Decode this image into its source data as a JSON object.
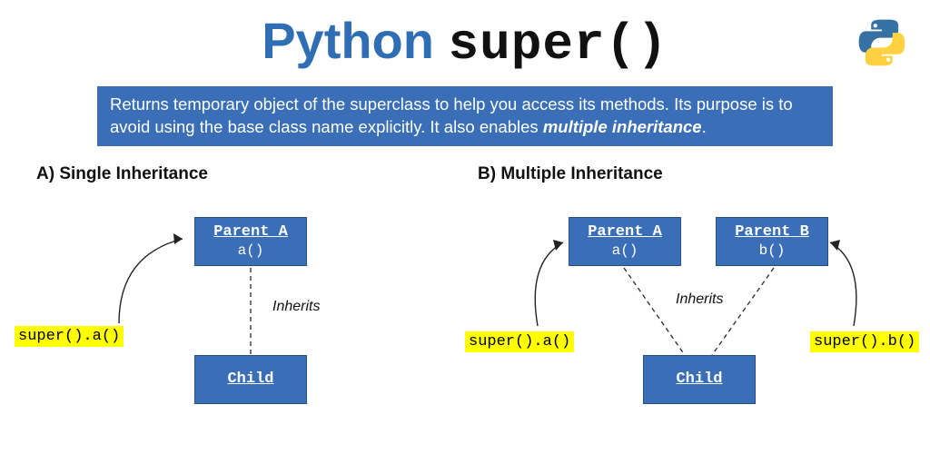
{
  "title": {
    "word1": "Python",
    "word2": "super()"
  },
  "description": {
    "text_before": "Returns temporary object of the superclass to help you access its methods. Its purpose is to avoid using the base class name explicitly. It also enables ",
    "emph": "multiple inheritance",
    "text_after": "."
  },
  "diagram_a": {
    "heading": "A) Single Inheritance",
    "parent_a": {
      "name": "Parent_A",
      "method": "a()"
    },
    "child": {
      "name": "Child"
    },
    "inherits_label": "Inherits",
    "call_a": "super().a()"
  },
  "diagram_b": {
    "heading": "B) Multiple Inheritance",
    "parent_a": {
      "name": "Parent_A",
      "method": "a()"
    },
    "parent_b": {
      "name": "Parent_B",
      "method": "b()"
    },
    "child": {
      "name": "Child"
    },
    "inherits_label": "Inherits",
    "call_a": "super().a()",
    "call_b": "super().b()"
  },
  "icons": {
    "python_logo": "python-logo-icon"
  }
}
